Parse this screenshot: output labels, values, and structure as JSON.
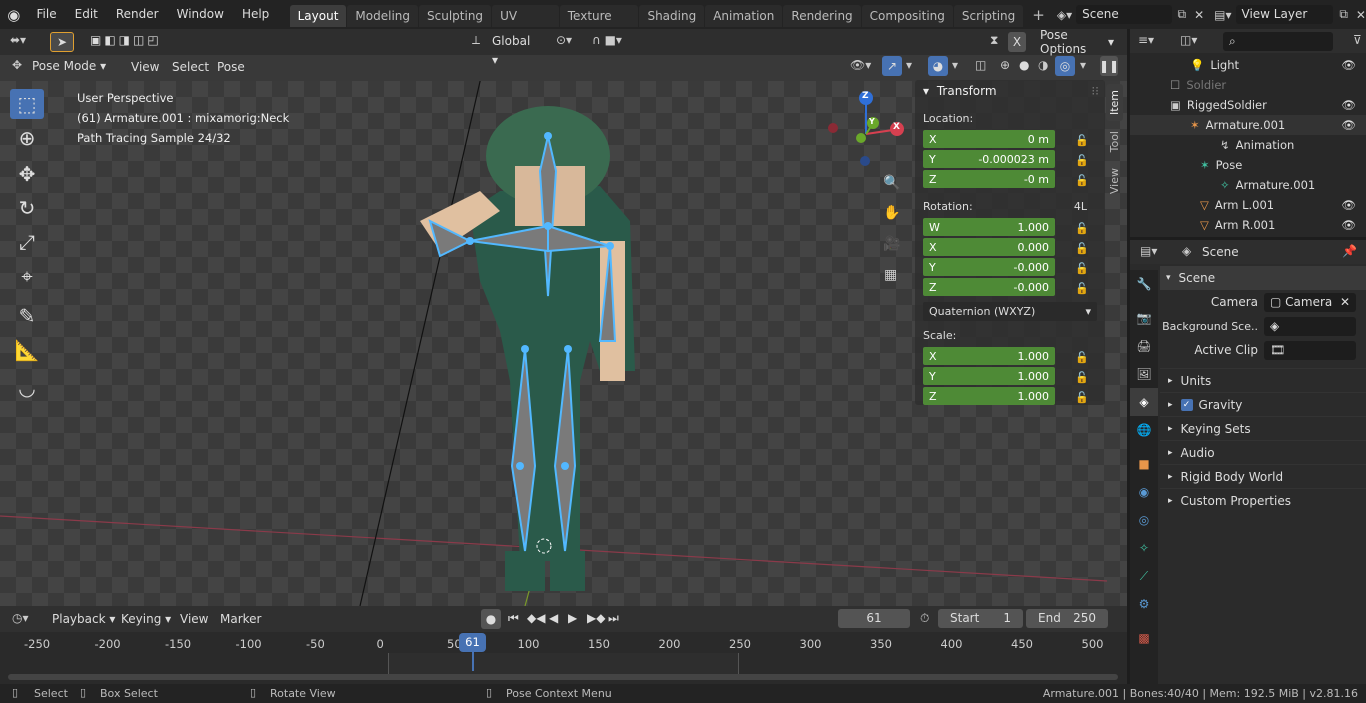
{
  "topbar": {
    "menus": [
      "File",
      "Edit",
      "Render",
      "Window",
      "Help"
    ],
    "workspaces": [
      "Layout",
      "Modeling",
      "Sculpting",
      "UV Editing",
      "Texture Paint",
      "Shading",
      "Animation",
      "Rendering",
      "Compositing",
      "Scripting"
    ],
    "active_workspace": "Layout",
    "scene": "Scene",
    "view_layer": "View Layer"
  },
  "viewport": {
    "orientation": "Global",
    "mode": "Pose Mode",
    "menus": [
      "View",
      "Select",
      "Pose"
    ],
    "pose_options": "Pose Options",
    "overlay_lines": [
      "User Perspective",
      "(61) Armature.001 : mixamorig:Neck",
      "Path Tracing Sample 24/32"
    ],
    "gizmo": {
      "x": "X",
      "y": "Y",
      "z": "Z"
    }
  },
  "npanel": {
    "title": "Transform",
    "tabs": [
      "Item",
      "Tool",
      "View"
    ],
    "location_label": "Location:",
    "location": [
      {
        "axis": "X",
        "value": "0 m"
      },
      {
        "axis": "Y",
        "value": "-0.000023 m"
      },
      {
        "axis": "Z",
        "value": "-0 m"
      }
    ],
    "rotation_label": "Rotation:",
    "rotation_mode_badge": "4L",
    "rotation": [
      {
        "axis": "W",
        "value": "1.000"
      },
      {
        "axis": "X",
        "value": "0.000"
      },
      {
        "axis": "Y",
        "value": "-0.000"
      },
      {
        "axis": "Z",
        "value": "-0.000"
      }
    ],
    "rotation_mode": "Quaternion (WXYZ)",
    "scale_label": "Scale:",
    "scale": [
      {
        "axis": "X",
        "value": "1.000"
      },
      {
        "axis": "Y",
        "value": "1.000"
      },
      {
        "axis": "Z",
        "value": "1.000"
      }
    ]
  },
  "outliner": {
    "rows": [
      "Light",
      "Soldier",
      "RiggedSoldier",
      "Armature.001",
      "Animation",
      "Pose",
      "Armature.001",
      "Arm L.001",
      "Arm R.001"
    ]
  },
  "properties": {
    "context": "Scene",
    "section": "Scene",
    "camera_label": "Camera",
    "camera_value": "Camera",
    "background_label": "Background Sce..",
    "active_clip_label": "Active Clip",
    "panels": [
      "Units",
      "Gravity",
      "Keying Sets",
      "Audio",
      "Rigid Body World",
      "Custom Properties"
    ]
  },
  "timeline": {
    "menus": [
      "Playback",
      "Keying",
      "View",
      "Marker"
    ],
    "current_frame": "61",
    "start_label": "Start",
    "start": "1",
    "end_label": "End",
    "end": "250",
    "ticks": [
      "-250",
      "-200",
      "-150",
      "-100",
      "-50",
      "0",
      "50",
      "100",
      "150",
      "200",
      "250",
      "300",
      "350",
      "400",
      "450",
      "500"
    ],
    "playhead": "61"
  },
  "statusbar": {
    "select": "Select",
    "box_select": "Box Select",
    "rotate": "Rotate View",
    "context_menu": "Pose Context Menu",
    "info": "Armature.001 | Bones:40/40 | Mem: 192.5 MiB | v2.81.16"
  }
}
